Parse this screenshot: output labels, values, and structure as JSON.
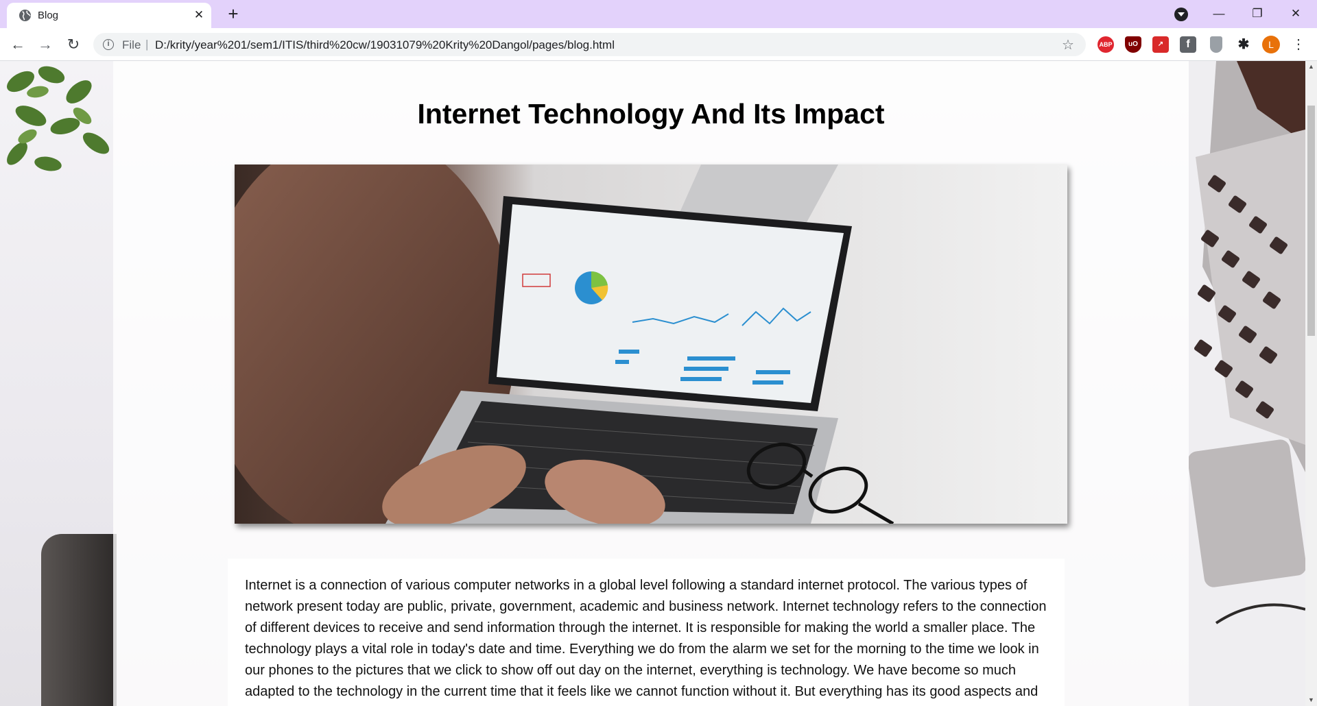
{
  "browser": {
    "tab": {
      "title": "Blog",
      "favicon": "globe-icon",
      "close": "✕"
    },
    "new_tab": "+",
    "window_controls": {
      "minimize": "—",
      "maximize": "❐",
      "close": "✕"
    },
    "nav": {
      "back": "←",
      "forward": "→",
      "reload": "↻"
    },
    "omnibox": {
      "info": "i",
      "scheme": "File",
      "separator": "|",
      "url": "D:/krity/year%201/sem1/ITIS/third%20cw/19031079%20Krity%20Dangol/pages/blog.html"
    },
    "extensions": [
      {
        "name": "adblock-plus-icon",
        "label": "ABP"
      },
      {
        "name": "ublock-icon",
        "label": "uO"
      },
      {
        "name": "red-extension-icon",
        "label": "↗"
      },
      {
        "name": "f-extension-icon",
        "label": "f"
      },
      {
        "name": "shield-extension-icon",
        "label": ""
      },
      {
        "name": "extensions-puzzle-icon",
        "label": "✱"
      }
    ],
    "profile_initial": "L",
    "menu": "⋮",
    "colors": {
      "tab_strip": "#e3d2fb",
      "profile": "#e8710a"
    }
  },
  "page": {
    "title": "Internet Technology And Its Impact",
    "hero_image": "person-using-laptop-with-analytics-dashboard",
    "article": "Internet is a connection of various computer networks in a global level following a standard internet protocol. The various types of network present today are public, private, government, academic and business network. Internet technology refers to the connection of different devices to receive and send information through the internet. It is responsible for making the world a smaller place. The technology plays a vital role in today's date and time. Everything we do from the alarm we set for the morning to the time we look in our phones to the pictures that we click to show off out day on the internet, everything is technology. We have become so much adapted to the technology in the current time that it feels like we cannot function without it. But everything has its good aspects and"
  },
  "scrollbar": {
    "up": "▲",
    "down": "▼",
    "position": 0.0
  }
}
